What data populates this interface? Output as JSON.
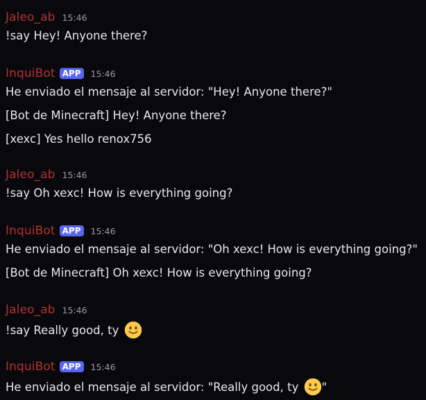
{
  "messages": [
    {
      "username": "Jaleo_ab",
      "badge": "",
      "time": "15:46",
      "lines": [
        "!say Hey! Anyone there?"
      ]
    },
    {
      "username": "InquiBot",
      "badge": "APP",
      "time": "15:46",
      "lines": [
        "He enviado el mensaje al servidor: \"Hey! Anyone there?\"",
        "[Bot de Minecraft] Hey! Anyone there?",
        "[xexc] Yes hello renox756"
      ]
    },
    {
      "username": "Jaleo_ab",
      "badge": "",
      "time": "15:46",
      "lines": [
        "!say Oh xexc! How is everything going?"
      ]
    },
    {
      "username": "InquiBot",
      "badge": "APP",
      "time": "15:46",
      "lines": [
        "He enviado el mensaje al servidor: \"Oh xexc! How is everything going?\"",
        "[Bot de Minecraft] Oh xexc! How is everything going?"
      ]
    },
    {
      "username": "Jaleo_ab",
      "badge": "",
      "time": "15:46",
      "line_before_emoji": "!say Really good, ty",
      "emoji": "slightly-smiling-face-icon"
    },
    {
      "username": "InquiBot",
      "badge": "APP",
      "time": "15:46",
      "line_before_emoji": "He enviado el mensaje al servidor: \"Really good, ty",
      "emoji": "slightly-smiling-face-icon",
      "line_after_emoji": "\""
    }
  ],
  "colors": {
    "background": "#09090d",
    "username": "#b3322f",
    "badge": "#5865f2",
    "timestamp": "#9a9ca3",
    "text": "#e8e9ec"
  }
}
